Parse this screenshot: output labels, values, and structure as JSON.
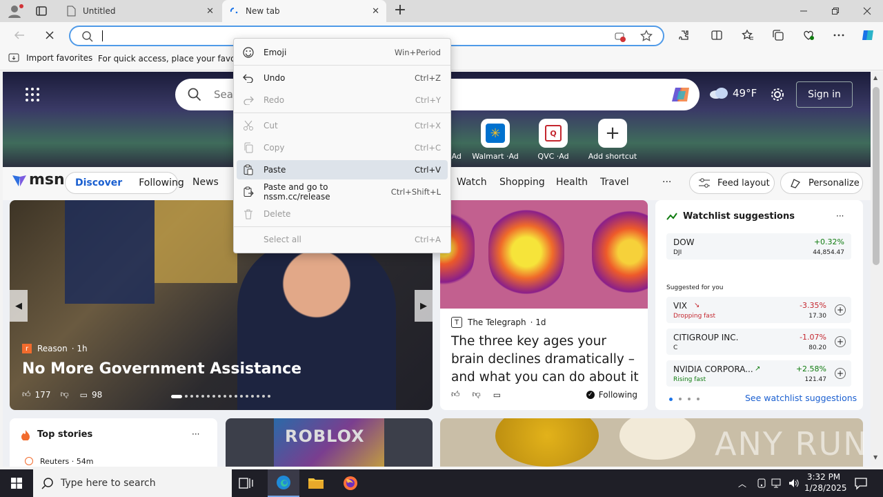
{
  "tabs": [
    {
      "title": "Untitled",
      "icon": "page-icon"
    },
    {
      "title": "New tab",
      "icon": "edge-loading-icon"
    }
  ],
  "address": {
    "value": "",
    "placeholder": ""
  },
  "favorites_bar": {
    "import_label": "Import favorites",
    "hint": "For quick access, place your favorites"
  },
  "msn": {
    "search_placeholder": "Sear",
    "weather": "49°F",
    "sign_in": "Sign in",
    "shortcuts": [
      {
        "label": "·Ad"
      },
      {
        "label": "Walmart ·Ad"
      },
      {
        "label": "QVC ·Ad"
      },
      {
        "label": "Add shortcut"
      }
    ],
    "logo": "msn",
    "tabs": [
      "Discover",
      "Following"
    ],
    "nav": [
      "News",
      "Watch",
      "Shopping",
      "Health",
      "Travel"
    ],
    "more": "···",
    "feed_layout": "Feed layout",
    "personalize": "Personalize",
    "hero_story": {
      "source": "Reason",
      "age": "· 1h",
      "headline": "No More Government Assistance",
      "likes": "177",
      "comments": "98"
    },
    "second_story": {
      "source": "The Telegraph",
      "age": "· 1d",
      "headline": "The three key ages your brain declines dramatically – and what you can do about it",
      "following": "Following"
    },
    "watchlist": {
      "title": "Watchlist suggestions",
      "top": {
        "name": "DOW",
        "ticker": "DJI",
        "change": "+0.32%",
        "price": "44,854.47"
      },
      "suggested_label": "Suggested for you",
      "items": [
        {
          "name": "VIX",
          "sub": "Dropping fast",
          "change": "-3.35%",
          "price": "17.30",
          "color": "#c4262e"
        },
        {
          "name": "CITIGROUP INC.",
          "sub": "C",
          "change": "-1.07%",
          "price": "80.20",
          "color": "#c4262e"
        },
        {
          "name": "NVIDIA CORPORA...",
          "sub": "Rising fast",
          "change": "+2.58%",
          "price": "121.47",
          "color": "#0f7b0f"
        }
      ],
      "see_more": "See watchlist suggestions"
    },
    "top_stories": {
      "title": "Top stories",
      "source": "Reuters · 54m"
    },
    "roblox": "ROBLOX"
  },
  "context_menu": [
    {
      "label": "Emoji",
      "shortcut": "Win+Period",
      "icon": "emoji-icon",
      "disabled": false
    },
    {
      "label": "Undo",
      "shortcut": "Ctrl+Z",
      "icon": "undo-icon",
      "disabled": false
    },
    {
      "label": "Redo",
      "shortcut": "Ctrl+Y",
      "icon": "redo-icon",
      "disabled": true
    },
    {
      "label": "Cut",
      "shortcut": "Ctrl+X",
      "icon": "cut-icon",
      "disabled": true
    },
    {
      "label": "Copy",
      "shortcut": "Ctrl+C",
      "icon": "copy-icon",
      "disabled": true
    },
    {
      "label": "Paste",
      "shortcut": "Ctrl+V",
      "icon": "paste-icon",
      "disabled": false,
      "highlighted": true
    },
    {
      "label": "Paste and go to nssm.cc/release",
      "shortcut": "Ctrl+Shift+L",
      "icon": "paste-go-icon",
      "disabled": false
    },
    {
      "label": "Delete",
      "shortcut": "",
      "icon": "delete-icon",
      "disabled": true
    },
    {
      "label": "Select all",
      "shortcut": "Ctrl+A",
      "icon": "",
      "disabled": true
    }
  ],
  "taskbar": {
    "search_placeholder": "Type here to search",
    "time": "3:32 PM",
    "date": "1/28/2025"
  },
  "watermark": "ANY RUN"
}
